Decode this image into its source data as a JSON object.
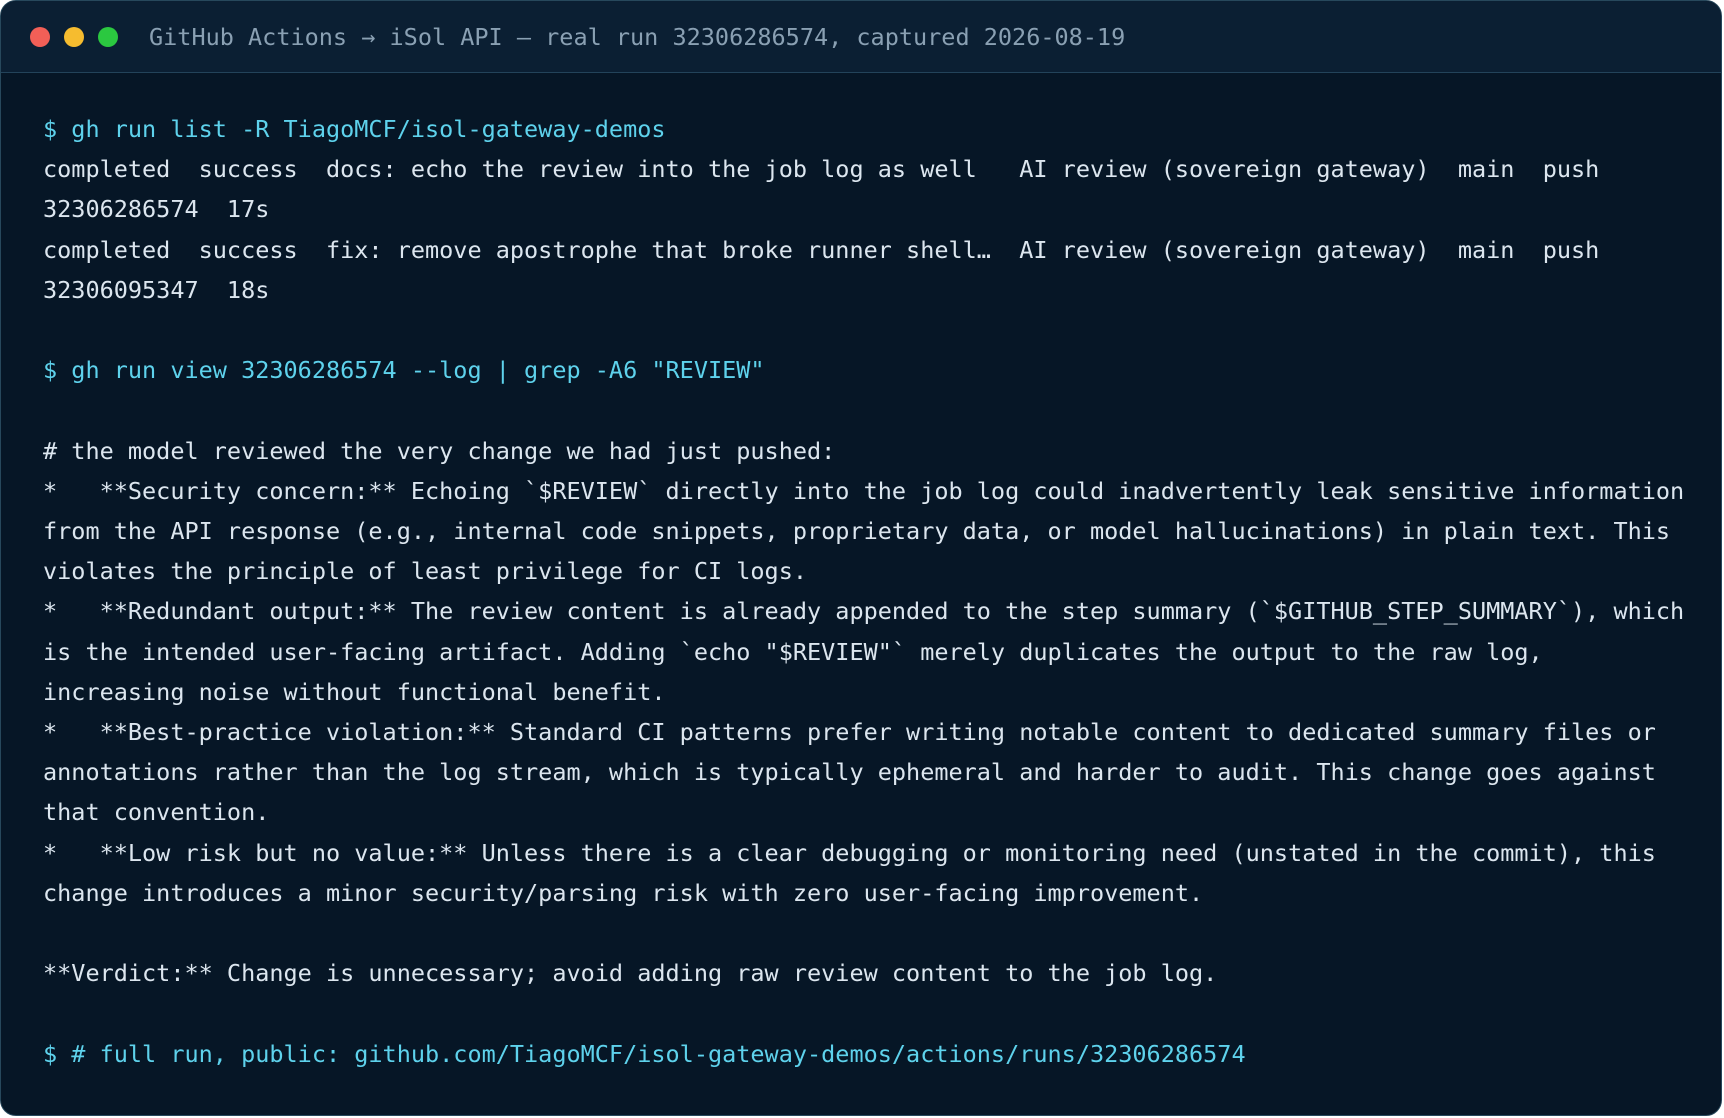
{
  "window": {
    "title": "GitHub Actions → iSol API — real run 32306286574, captured 2026-08-19",
    "controls": {
      "close_color": "#f25f57",
      "minimize_color": "#f6bc2f",
      "maximize_color": "#2bc840"
    }
  },
  "terminal": {
    "prompt_color": "#5ed2ec",
    "output_color": "#dce6ef",
    "background": "#061626",
    "lines": [
      {
        "type": "cmd",
        "text": "$ gh run list -R TiagoMCF/isol-gateway-demos"
      },
      {
        "type": "out",
        "text": "completed  success  docs: echo the review into the job log as well   AI review (sovereign gateway)  main  push  32306286574  17s"
      },
      {
        "type": "out",
        "text": "completed  success  fix: remove apostrophe that broke runner shell…  AI review (sovereign gateway)  main  push  32306095347  18s"
      },
      {
        "type": "blank",
        "text": ""
      },
      {
        "type": "cmd",
        "text": "$ gh run view 32306286574 --log | grep -A6 \"REVIEW\""
      },
      {
        "type": "blank",
        "text": ""
      },
      {
        "type": "out",
        "text": "# the model reviewed the very change we had just pushed:"
      },
      {
        "type": "out",
        "text": "*   **Security concern:** Echoing `$REVIEW` directly into the job log could inadvertently leak sensitive information from the API response (e.g., internal code snippets, proprietary data, or model hallucinations) in plain text. This violates the principle of least privilege for CI logs."
      },
      {
        "type": "out",
        "text": "*   **Redundant output:** The review content is already appended to the step summary (`$GITHUB_STEP_SUMMARY`), which is the intended user-facing artifact. Adding `echo \"$REVIEW\"` merely duplicates the output to the raw log, increasing noise without functional benefit."
      },
      {
        "type": "out",
        "text": "*   **Best-practice violation:** Standard CI patterns prefer writing notable content to dedicated summary files or annotations rather than the log stream, which is typically ephemeral and harder to audit. This change goes against that convention."
      },
      {
        "type": "out",
        "text": "*   **Low risk but no value:** Unless there is a clear debugging or monitoring need (unstated in the commit), this change introduces a minor security/parsing risk with zero user-facing improvement."
      },
      {
        "type": "blank",
        "text": ""
      },
      {
        "type": "out",
        "text": "**Verdict:** Change is unnecessary; avoid adding raw review content to the job log."
      },
      {
        "type": "blank",
        "text": ""
      },
      {
        "type": "cmd",
        "text": "$ # full run, public: github.com/TiagoMCF/isol-gateway-demos/actions/runs/32306286574"
      }
    ]
  }
}
